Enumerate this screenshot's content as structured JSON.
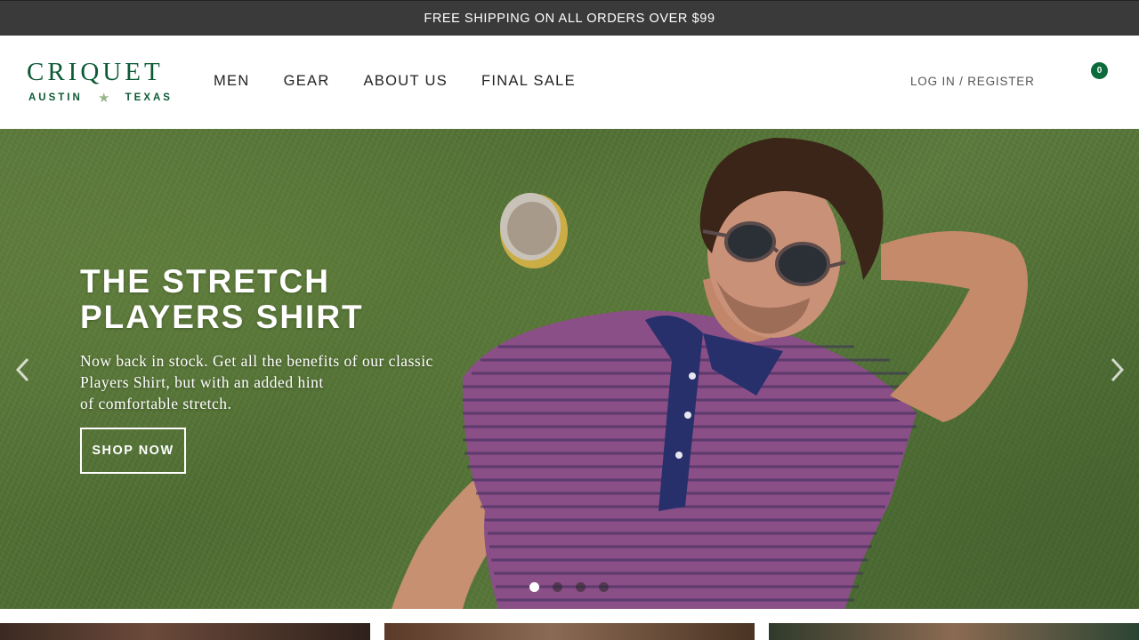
{
  "promo": {
    "text": "FREE SHIPPING ON ALL ORDERS OVER $99"
  },
  "brand": {
    "name": "CRIQUET",
    "city": "AUSTIN",
    "state": "TEXAS",
    "color": "#0b5a35"
  },
  "nav": {
    "items": [
      "MEN",
      "GEAR",
      "ABOUT US",
      "FINAL SALE"
    ]
  },
  "account": {
    "login": "LOG IN",
    "separator": "/",
    "register": "REGISTER"
  },
  "cart": {
    "count": "0",
    "badge_color": "#0b6b3a"
  },
  "hero": {
    "title_line1": "THE STRETCH",
    "title_line2": "PLAYERS SHIRT",
    "text_lines": [
      "Now back in stock. Get all the benefits of our classic",
      "Players Shirt, but with an added hint",
      "of comfortable stretch."
    ],
    "button": "SHOP NOW",
    "prev_icon": "chevron-left-icon",
    "next_icon": "chevron-right-icon",
    "slides": 4,
    "active_slide": 1
  }
}
